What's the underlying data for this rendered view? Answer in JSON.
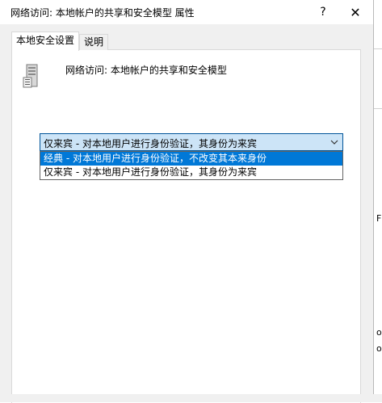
{
  "window": {
    "title": "网络访问: 本地帐户的共享和安全模型 属性",
    "help_glyph": "?",
    "close_glyph": "✕"
  },
  "tabs": [
    {
      "label": "本地安全设置",
      "active": true
    },
    {
      "label": "说明",
      "active": false
    }
  ],
  "policy": {
    "name": "网络访问: 本地帐户的共享和安全模型",
    "icon": "policy-computer-icon"
  },
  "combobox": {
    "selected_value": "仅来宾 - 对本地用户进行身份验证，其身份为来宾",
    "expanded": true,
    "options": [
      {
        "label": "经典 - 对本地用户进行身份验证，不改变其本来身份",
        "highlighted": true
      },
      {
        "label": "仅来宾 - 对本地用户进行身份验证，其身份为来宾",
        "highlighted": false
      }
    ]
  },
  "background_window": {
    "fragments": [
      "F",
      "o",
      "o"
    ]
  },
  "colors": {
    "dialog_bg": "#f0f0f0",
    "highlight": "#0078d7",
    "combo_focus_bg": "#cce4f7",
    "combo_border": "#005499"
  }
}
